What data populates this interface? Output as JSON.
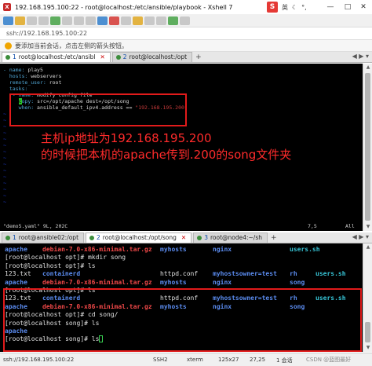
{
  "window": {
    "title": "192.168.195.100:22 - root@localhost:/etc/ansible/playbook - Xshell 7",
    "app_icon_letter": "X",
    "ime": {
      "logo": "S",
      "lang": "英"
    }
  },
  "address": {
    "value": "ssh://192.168.195.100:22"
  },
  "tip": {
    "text": "要添加当前会话，点击左侧的箭头按钮。"
  },
  "top_tabs": [
    {
      "num": "1",
      "label": "root@localhost:/etc/ansibl"
    },
    {
      "num": "2",
      "label": "root@localhost:/opt"
    }
  ],
  "vim": {
    "lines": [
      {
        "k": "- name:",
        "v": " play5"
      },
      {
        "k": "  hosts:",
        "v": " webservers"
      },
      {
        "k": "  remote_user:",
        "v": " root"
      },
      {
        "k": "  tasks:",
        "v": ""
      },
      {
        "k": "   - name:",
        "v": " modify config file"
      },
      {
        "cur": "c",
        "k": "opy:",
        "v": " src=/opt/apache dest=/opt/song"
      },
      {
        "k": "     when:",
        "v": " ansible_default_ipv4.address == ",
        "s": "\"192.168.195.200\""
      }
    ],
    "tilde_count": 15,
    "status_file": "\"demo5.yaml\" 9L, 202C",
    "status_pos": "7,5",
    "status_all": "All"
  },
  "annotation": {
    "line1": "主机ip地址为192.168.195.200",
    "line2": "的时候把本机的apache传到.200的song文件夹"
  },
  "bottom_tabs": [
    {
      "num": "1",
      "label": "root@ansible02:/opt"
    },
    {
      "num": "2",
      "label": "root@localhost:/opt/song"
    },
    {
      "num": "3",
      "label": "root@node4:~/sh"
    }
  ],
  "terminal": {
    "row1": {
      "a": "apache",
      "b": "debian-7.0-x86-minimal.tar.gz",
      "c": "myhosts",
      "d": "nginx",
      "e": "users.sh"
    },
    "row2": "[root@localhost opt]# mkdir song",
    "row3": "[root@localhost opt]# ls",
    "row4": {
      "a": "123.txt",
      "b": "containerd",
      "c": "httpd.conf",
      "d": "myhostsowner=test",
      "e": "rh",
      "f": "users.sh"
    },
    "row5": {
      "a": "apache",
      "b": "debian-7.0-x86-minimal.tar.gz",
      "c": "myhosts",
      "d": "nginx",
      "e": "song"
    },
    "row6": "[root@localhost opt]# ls",
    "row7": {
      "a": "123.txt",
      "b": "containerd",
      "c": "httpd.conf",
      "d": "myhostsowner=test",
      "e": "rh",
      "f": "users.sh"
    },
    "row8": {
      "a": "apache",
      "b": "debian-7.0-x86-minimal.tar.gz",
      "c": "myhosts",
      "d": "nginx",
      "e": "song"
    },
    "row9": "[root@localhost opt]# cd song/",
    "row10": "[root@localhost song]# ls",
    "row11": "apache",
    "row12": "[root@localhost song]# ls"
  },
  "statusbar": {
    "address": "ssh://192.168.195.100:22",
    "protocol": "SSH2",
    "term": "xterm",
    "size": "125x27",
    "position": "27,25",
    "sessions": "1 会话",
    "watermark": "CSDN @蓝图最好"
  },
  "colors": {
    "annotation_red": "#ff2b2b",
    "term_blue": "#5b8cf0",
    "term_red": "#f04848",
    "term_cyan": "#37c4d6"
  }
}
